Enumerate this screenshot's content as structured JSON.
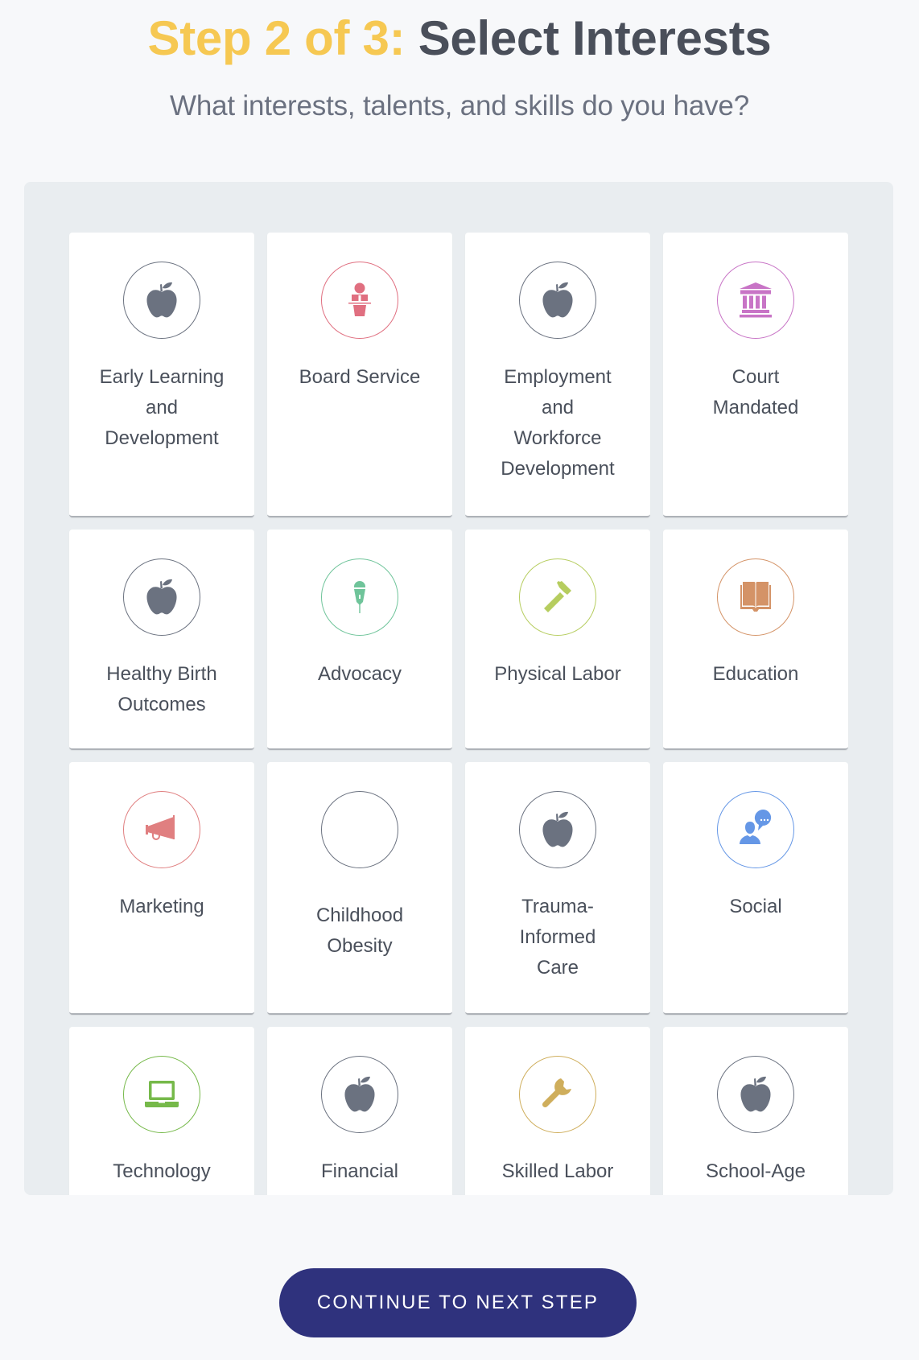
{
  "header": {
    "step_label": "Step 2 of 3:",
    "title": "Select Interests",
    "subtitle": "What interests, talents, and skills do you have?"
  },
  "colors": {
    "step_accent": "#f6c852",
    "title_text": "#4a4f5a",
    "button_bg": "#2f327d",
    "gray_icon": "#6b7280",
    "board_service": "#e06f80",
    "court_mandated": "#c874c6",
    "advocacy": "#6fc49a",
    "physical_labor": "#b6cd5f",
    "education": "#d49367",
    "marketing": "#e07f80",
    "social": "#6597e6",
    "technology": "#76b94a",
    "skilled_labor": "#cfae5c"
  },
  "interests": [
    {
      "label": "Early Learning\nand\nDevelopment",
      "icon": "apple-icon",
      "color": "#6b7280"
    },
    {
      "label": "Board Service",
      "icon": "podium-icon",
      "color": "#e06f80"
    },
    {
      "label": "Employment\nand\nWorkforce\nDevelopment",
      "icon": "apple-icon",
      "color": "#6b7280"
    },
    {
      "label": "Court\nMandated",
      "icon": "courthouse-icon",
      "color": "#c874c6"
    },
    {
      "label": "Healthy Birth\nOutcomes",
      "icon": "apple-icon",
      "color": "#6b7280"
    },
    {
      "label": "Advocacy",
      "icon": "microphone-icon",
      "color": "#6fc49a"
    },
    {
      "label": "Physical Labor",
      "icon": "hammer-icon",
      "color": "#b6cd5f"
    },
    {
      "label": "Education",
      "icon": "book-icon",
      "color": "#d49367"
    },
    {
      "label": "Marketing",
      "icon": "megaphone-icon",
      "color": "#e07f80"
    },
    {
      "label": "Childhood\nObesity",
      "icon": "empty-icon",
      "color": "#6b7280"
    },
    {
      "label": "Trauma-\nInformed\nCare",
      "icon": "apple-icon",
      "color": "#6b7280"
    },
    {
      "label": "Social",
      "icon": "people-chat-icon",
      "color": "#6597e6"
    },
    {
      "label": "Technology",
      "icon": "laptop-icon",
      "color": "#76b94a"
    },
    {
      "label": "Financial",
      "icon": "apple-icon",
      "color": "#6b7280"
    },
    {
      "label": "Skilled Labor",
      "icon": "wrench-icon",
      "color": "#cfae5c"
    },
    {
      "label": "School-Age",
      "icon": "apple-icon",
      "color": "#6b7280"
    }
  ],
  "footer": {
    "continue_label": "CONTINUE TO NEXT STEP"
  }
}
